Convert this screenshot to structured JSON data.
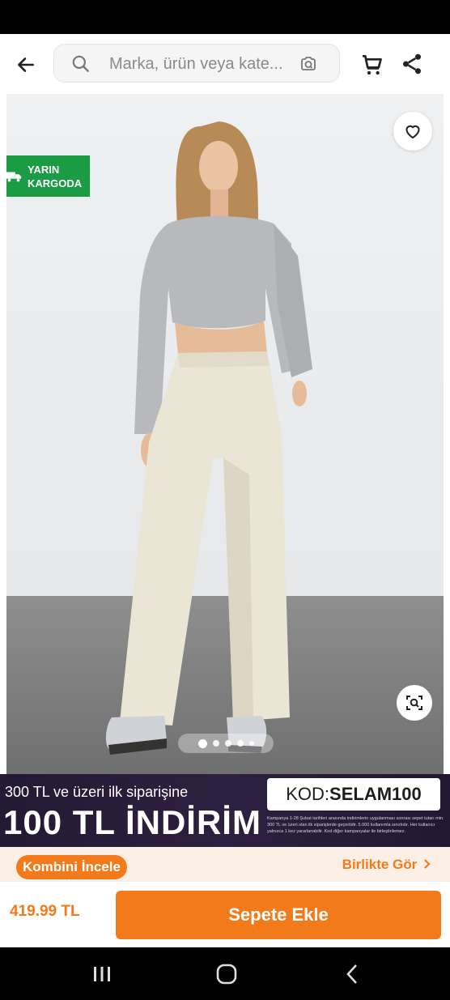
{
  "header": {
    "search_placeholder": "Marka, ürün veya kate...",
    "icons": [
      "back-arrow-icon",
      "search-icon",
      "camera-search-icon",
      "cart-icon",
      "share-icon"
    ]
  },
  "product_image": {
    "badge_line1": "YARIN",
    "badge_line2": "KARGODA",
    "carousel_total": 5,
    "carousel_active": 1,
    "colors": {
      "badge": "#1a9b44"
    }
  },
  "promo": {
    "line1": "300 TL ve üzeri ilk siparişine",
    "line2": "100 TL İNDİRİM",
    "code_label": "KOD: ",
    "code_value": "SELAM100",
    "fine_print": "Kampanya 1-28 Şubat tarihleri arasında indirimlerin uygulanması sonrası sepet tutarı min. 300 TL ve üzeri olan ilk siparişlerde geçerlidir. 5.000 kullanımla sınırlıdır. Her kullanıcı yalnızca 1 kez yararlanabilir. Kod diğer kampanyalar ile birleştirilemez."
  },
  "combo": {
    "button_label": "Kombini İncele",
    "link_label": "Birlikte Gör"
  },
  "purchase": {
    "price": "419.99 TL",
    "add_to_cart_label": "Sepete Ekle"
  },
  "colors": {
    "accent": "#f27a1a",
    "combo_bg": "#fcefe6",
    "promo_bg": "#241a33"
  }
}
